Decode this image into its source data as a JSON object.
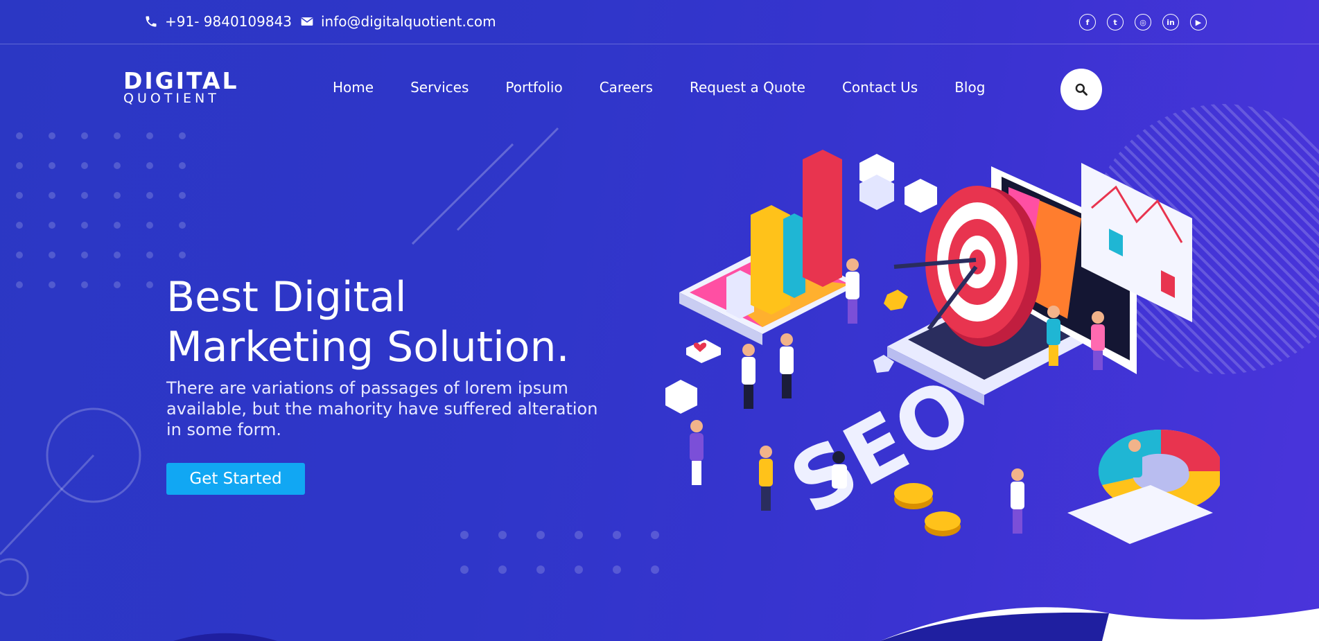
{
  "topbar": {
    "phone": "+91- 9840109843",
    "email": "info@digitalquotient.com",
    "social": [
      {
        "icon": "facebook-icon",
        "glyph": "f"
      },
      {
        "icon": "twitter-icon",
        "glyph": "t"
      },
      {
        "icon": "instagram-icon",
        "glyph": "◎"
      },
      {
        "icon": "linkedin-icon",
        "glyph": "in"
      },
      {
        "icon": "youtube-icon",
        "glyph": "▶"
      }
    ]
  },
  "logo": {
    "line1": "DIGITAL",
    "line2": "QUOTIENT"
  },
  "nav": {
    "items": [
      "Home",
      "Services",
      "Portfolio",
      "Careers",
      "Request a Quote",
      "Contact Us",
      "Blog"
    ]
  },
  "search": {
    "icon": "search-icon"
  },
  "hero": {
    "title_line1": "Best Digital",
    "title_line2": "Marketing Solution.",
    "description": "There are variations of passages of lorem ipsum available, but the mahority have suffered alteration in some form.",
    "cta_label": "Get Started"
  },
  "illustration": {
    "seo_text": "SEO"
  },
  "colors": {
    "background": "#2f36c9",
    "cta": "#11a7f3",
    "accent_red": "#e8344f",
    "accent_yellow": "#ffc21a"
  }
}
